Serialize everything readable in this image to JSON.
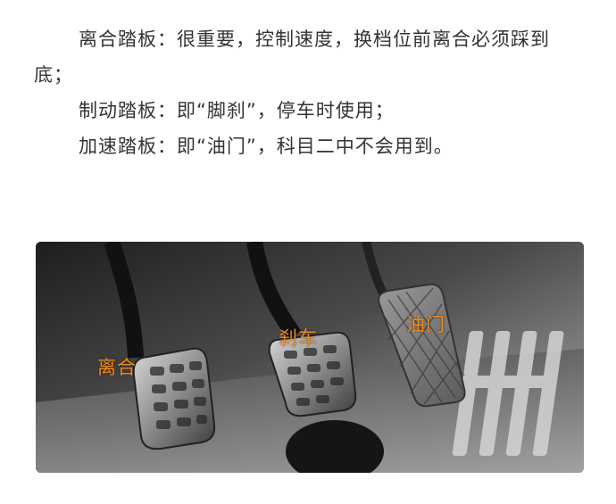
{
  "article": {
    "paragraphs": [
      "离合踏板：很重要，控制速度，换档位前离合必须踩到底；",
      "制动踏板：即“脚刹”，停车时使用；",
      "加速踏板：即“油门”，科目二中不会用到。"
    ]
  },
  "photo": {
    "labels": {
      "clutch": "离合",
      "brake": "刹车",
      "accelerator": "油门"
    },
    "label_color": "#f28a1c"
  }
}
